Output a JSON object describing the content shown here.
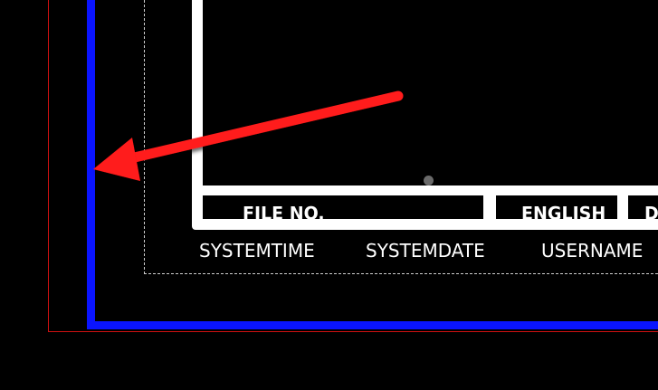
{
  "title_block": {
    "file_no_label": "FILE NO.",
    "language_label": "ENGLISH",
    "truncated_label": "D"
  },
  "attributes": {
    "system_time": "SYSTEMTIME",
    "system_date": "SYSTEMDATE",
    "user_name": "USERNAME"
  },
  "annotation": {
    "arrow_icon": "red-arrow-pointing-left",
    "arrow_color": "#ff1a1a"
  },
  "colors": {
    "background": "#000000",
    "blue_border": "#0a14ff",
    "red_border": "#d01010",
    "title_block": "#ffffff",
    "viewport_dash": "#cfcfcf"
  }
}
